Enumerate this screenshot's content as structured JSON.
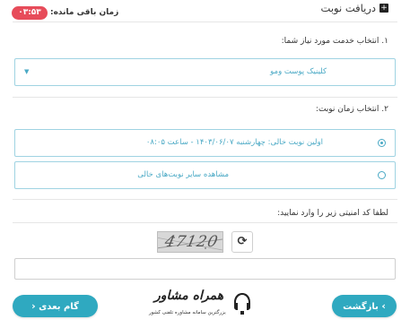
{
  "header": {
    "title": "دریافت نوبت",
    "timer_label": "زمان باقی مانده:",
    "timer_value": "۰۳:۵۳"
  },
  "step1": {
    "label": "۱. انتخاب خدمت مورد نیاز شما:",
    "selected_value": "کلینیک پوست ومو"
  },
  "step2": {
    "label": "۲. انتخاب زمان نوبت:",
    "options": [
      {
        "label": "اولین نوبت خالی: چهارشنبه ۱۴۰۳/۰۶/۰۷ - ساعت ۰۸:۰۵",
        "checked": true
      },
      {
        "label": "مشاهده سایر نوبت‌های خالی",
        "checked": false
      }
    ]
  },
  "captcha": {
    "label": "لطفا کد امنیتی زیر را وارد نمایید:",
    "code_image_text": "47120",
    "input_value": ""
  },
  "buttons": {
    "next_label": "گام بعدی",
    "back_label": "بازگشت"
  },
  "watermark": {
    "title": "همراه مشاور",
    "subtitle": "بزرگترین سامانه مشاوره تلفنی کشور"
  },
  "colors": {
    "accent": "#2fa9c0",
    "field_border": "#9fd3e2",
    "timer_badge": "#e74c5a"
  }
}
